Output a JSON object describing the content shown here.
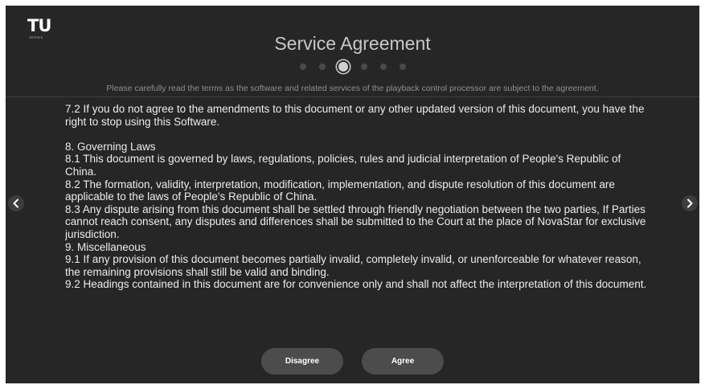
{
  "logo": {
    "mark": "TU",
    "sub": "SERIES"
  },
  "header": {
    "title": "Service Agreement",
    "subtitle": "Please carefully read the terms as the software and related services of the playback control processor are subject to the agreement."
  },
  "pager": {
    "total": 6,
    "current": 3
  },
  "content": {
    "lines": [
      "7.2 If you do not agree to the amendments to this document or any other updated version of this document, you have the right to stop using this Software.",
      "",
      "8. Governing Laws",
      "8.1 This document is governed by laws, regulations, policies, rules and judicial interpretation of People's Republic of China.",
      "8.2 The formation, validity, interpretation, modification, implementation, and dispute resolution of this document are applicable to the laws of People's Republic of China.",
      "8.3 Any dispute arising from this document shall be settled through friendly negotiation between the two parties, If Parties cannot reach consent, any disputes and differences shall be submitted to the Court at the place of NovaStar for exclusive jurisdiction.",
      "9. Miscellaneous",
      "9.1 If any provision of this document becomes partially invalid, completely invalid, or unenforceable for whatever reason, the remaining provisions shall still be valid and binding.",
      "9.2 Headings contained in this document are for convenience only and shall not affect the interpretation of this document."
    ]
  },
  "nav": {
    "prev_icon": "chevron-left-icon",
    "next_icon": "chevron-right-icon"
  },
  "actions": {
    "disagree_label": "Disagree",
    "agree_label": "Agree"
  }
}
